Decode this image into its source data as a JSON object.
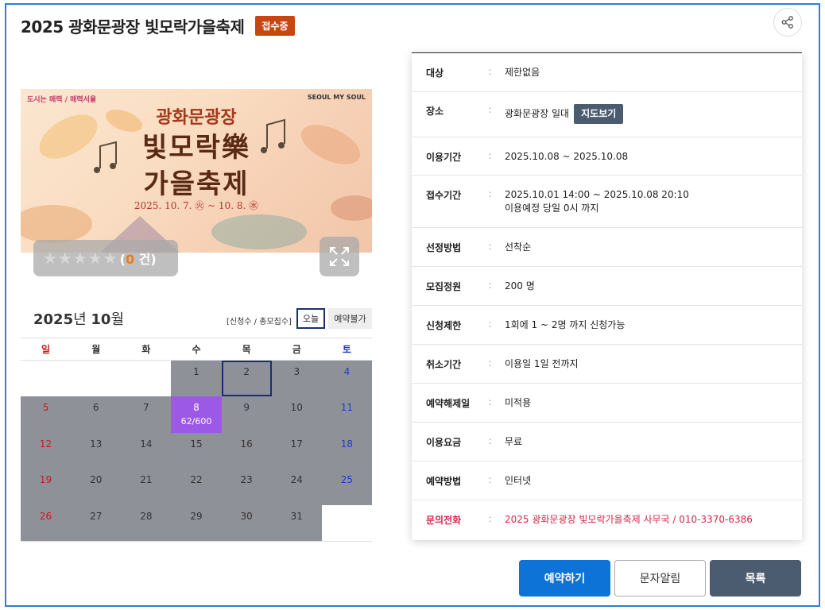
{
  "header": {
    "title": "2025 광화문광장 빛모락가을축제",
    "status_badge": "접수중"
  },
  "poster": {
    "logo_left": "도시는 매력 / 매력서울",
    "logo_right": "SEOUL MY SOUL",
    "line1": "광화문광장",
    "line2": "빛모락樂",
    "line3": "가을축제",
    "date": "2025. 10. 7. ㊋ ~ 10. 8. ㊌"
  },
  "rating": {
    "stars": "★★★★★",
    "open": "(",
    "count": "0",
    "unit": " 건)"
  },
  "calendar": {
    "year": "2025",
    "year_suffix": "년 ",
    "month": "10",
    "month_suffix": "월",
    "legend": "[신청수 / 총모집수]",
    "today_label": "오늘",
    "unavailable_label": "예약불가",
    "weekdays": [
      "일",
      "월",
      "화",
      "수",
      "목",
      "금",
      "토"
    ],
    "weeks": [
      [
        "",
        "",
        "",
        "1",
        "2",
        "3",
        "4"
      ],
      [
        "5",
        "6",
        "7",
        "8",
        "9",
        "10",
        "11"
      ],
      [
        "12",
        "13",
        "14",
        "15",
        "16",
        "17",
        "18"
      ],
      [
        "19",
        "20",
        "21",
        "22",
        "23",
        "24",
        "25"
      ],
      [
        "26",
        "27",
        "28",
        "29",
        "30",
        "31",
        ""
      ]
    ],
    "selected_sub": "62/600"
  },
  "info": {
    "rows": [
      {
        "label": "대상",
        "value": "제한없음"
      },
      {
        "label": "장소",
        "value": "광화문광장 일대",
        "button": "지도보기"
      },
      {
        "label": "이용기간",
        "value": "2025.10.08 ~ 2025.10.08"
      },
      {
        "label": "접수기간",
        "value": "2025.10.01 14:00 ~ 2025.10.08 20:10",
        "value2": "이용예정 당일 0시 까지"
      },
      {
        "label": "선정방법",
        "value": "선착순"
      },
      {
        "label": "모집정원",
        "value": "200 명"
      },
      {
        "label": "신청제한",
        "value": "1회에 1 ~ 2명 까지 신청가능"
      },
      {
        "label": "취소기간",
        "value": "이용일 1일 전까지"
      },
      {
        "label": "예약해제일",
        "value": "미적용"
      },
      {
        "label": "이용요금",
        "value": "무료"
      },
      {
        "label": "예약방법",
        "value": "인터넷"
      },
      {
        "label": "문의전화",
        "value": "2025 광화문광장 빛모락가을축제 사무국 / 010-3370-6386"
      }
    ],
    "colon": ":"
  },
  "buttons": {
    "reserve": "예약하기",
    "sms": "문자알림",
    "list": "목록"
  },
  "colors": {
    "accent": "#0d73d6",
    "badge": "#c8460f",
    "selected_day": "#9b59e6",
    "contact": "#d4264a"
  }
}
